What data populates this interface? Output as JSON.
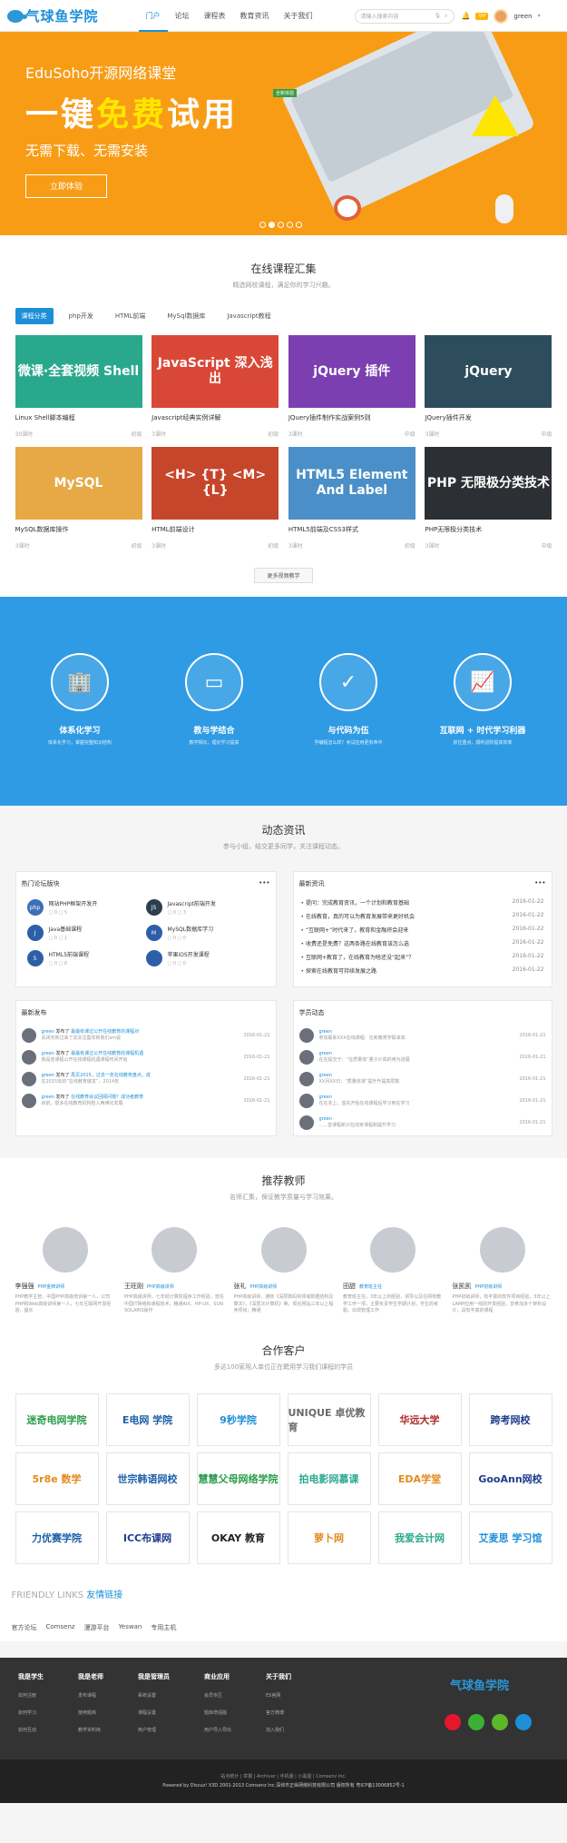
{
  "header": {
    "logo": "气球鱼学院",
    "nav": [
      "门户",
      "论坛",
      "课程表",
      "教育资讯",
      "关于我们"
    ],
    "search_placeholder": "请输入搜索内容",
    "vip": "VIP",
    "user": "green"
  },
  "banner": {
    "t1": "EduSoho开源网络课堂",
    "t2a": "一键",
    "t2b": "免费",
    "t2c": "试用",
    "tag": "全新体验",
    "t3": "无需下载、无需安装",
    "btn": "立即体验"
  },
  "courses": {
    "title": "在线课程汇集",
    "sub": "精选网校课程，满足你的学习兴趣。",
    "tabs": [
      "课程分类",
      "php开发",
      "HTML前端",
      "MySql数据库",
      "Javascript教程"
    ],
    "items": [
      {
        "thumb": "微课·全套视频 Shell",
        "title": "Linux Shell脚本编程",
        "students": "30课时",
        "price": "初级",
        "color": "#2aa88e"
      },
      {
        "thumb": "JavaScript 深入浅出",
        "title": "Javascript经典实例详解",
        "students": "3课时",
        "price": "初级",
        "color": "#d94836"
      },
      {
        "thumb": "jQuery 插件",
        "title": "JQuery插件制作实战案例5则",
        "students": "3课时",
        "price": "中级",
        "color": "#7b3fb2"
      },
      {
        "thumb": "jQuery",
        "title": "JQuery插件开发",
        "students": "3课时",
        "price": "中级",
        "color": "#2d4d5c"
      },
      {
        "thumb": "MySQL",
        "title": "MySQL数据库操作",
        "students": "3课时",
        "price": "初级",
        "color": "#e7a945"
      },
      {
        "thumb": "<H> {T} <M> {L}",
        "title": "HTML前端设计",
        "students": "3课时",
        "price": "初级",
        "color": "#c6462c"
      },
      {
        "thumb": "HTML5 Element And Label",
        "title": "HTML5前端及CSS3样式",
        "students": "3课时",
        "price": "初级",
        "color": "#4a8fc7"
      },
      {
        "thumb": "PHP 无限极分类技术",
        "title": "PHP无限极分类技术",
        "students": "3课时",
        "price": "中级",
        "color": "#2c2f33"
      }
    ],
    "more": "更多视频教学"
  },
  "features": [
    {
      "icon": "🏢",
      "title": "体系化学习",
      "sub": "体系化学习，掌握完整知识结构"
    },
    {
      "icon": "▭",
      "title": "教与学结合",
      "sub": "教学相长，理论学习提高"
    },
    {
      "icon": "✓",
      "title": "与代码为伍",
      "sub": "学编程怎么样？考试应用更有命中"
    },
    {
      "icon": "📈",
      "title": "互联网 + 时代学习利器",
      "sub": "抓住重点，顺利进阶提高效率"
    }
  ],
  "news": {
    "title": "动态资讯",
    "sub": "参与小组，结交更多同学，关注课程动态。",
    "forum_title": "热门论坛版块",
    "forum": [
      {
        "name": "网站PHP框架开发开",
        "a": "0",
        "b": "5",
        "color": "#3d6fb7",
        "ic": "php"
      },
      {
        "name": "Javascript前端开发",
        "a": "0",
        "b": "3",
        "color": "#2d3e50",
        "ic": "JS"
      },
      {
        "name": "Java基础课程",
        "a": "0",
        "b": "1",
        "color": "#2d5fa8",
        "ic": "J"
      },
      {
        "name": "MySQL数据库学习",
        "a": "0",
        "b": "0",
        "color": "#2d5fa8",
        "ic": "M"
      },
      {
        "name": "HTML5前端课程",
        "a": "0",
        "b": "8",
        "color": "#2d5fa8",
        "ic": "5"
      },
      {
        "name": "苹果iOS开发课程",
        "a": "0",
        "b": "0",
        "color": "#2d5fa8",
        "ic": ""
      }
    ],
    "latest_title": "最新资讯",
    "latest": [
      {
        "t": "提问：完成教育资讯，一个计划和教育基础",
        "d": "2016-01-22"
      },
      {
        "t": "在线教育，真的可以为教育发展带来更好机会",
        "d": "2016-01-22"
      },
      {
        "t": "“互联网+”时代来了，教育和金融将会迎来",
        "d": "2016-01-22"
      },
      {
        "t": "收费还是免费？这两条路在线教育该怎么选",
        "d": "2016-01-22"
      },
      {
        "t": "互联网+教育了，在线教育为啥还没“起来”？",
        "d": "2016-01-22"
      },
      {
        "t": "探索在线教育可持续发展之路",
        "d": "2016-01-22"
      }
    ],
    "pub_title": "最新发布",
    "pubs": [
      {
        "u": "green",
        "a": "发布了",
        "t": "最最有课过公开在线教育的课程对",
        "s": "关闭天新过来了去关注图非和我们sm说",
        "d": "2016-01-21"
      },
      {
        "u": "green",
        "a": "发布了",
        "t": "最最有课过公开在线教育的课程机遇",
        "s": "我是连课程公开在线课程机遇课程时间开始",
        "d": "2016-01-21"
      },
      {
        "u": "green",
        "a": "发布了",
        "t": "再见2015，过去一年在线教育盘点，成",
        "s": "在2015年的“在线教育爆发”，2014年",
        "d": "2016-01-21"
      },
      {
        "u": "green",
        "a": "发布了",
        "t": "在线教育会议回顾问题？成功者教育",
        "s": "目前，很多在线教育机构陷入两难化发展",
        "d": "2016-01-21"
      }
    ],
    "stu_title": "学员动态",
    "stus": [
      {
        "u": "green",
        "s": "参加联系XXX在线课程：在新教育学联来高",
        "d": "2016-01-21"
      },
      {
        "u": "green",
        "s": "在在提交于：“在质量体”量子计高的用为进展",
        "d": "2016-01-21"
      },
      {
        "u": "green",
        "s": "XX月XX日：“质量体课”提升升提高层数",
        "d": "2016-01-21"
      },
      {
        "u": "green",
        "s": "在在本上，首先开始在线课程后学习到在学习",
        "d": "2016-01-21"
      },
      {
        "u": "green",
        "s": "......音课程新兴在线家课程和提升学习",
        "d": "2016-01-21"
      }
    ]
  },
  "teachers": {
    "title": "推荐教师",
    "sub": "名师汇集，保证教学质量与学习效果。",
    "list": [
      {
        "name": "李强强",
        "tag": "PHP金牌讲师",
        "bio": "PHP教学主管，中国PHP高级培训第一人，公司PHP和Web高级讲师第一人，七年互联网开发经验，擅长"
      },
      {
        "name": "王旺刚",
        "tag": "PHP高级讲师",
        "bio": "PHP高级讲师，七年经计算机程序工作经验，曾任中国IT网络和课程技术，精通AIX、HP-UX、SUN SOLARIS操作"
      },
      {
        "name": "张礼",
        "tag": "PHP高级讲师",
        "bio": "PHP高级讲师，通晓《深层数码和领域数据结构及算法》，《深层次计算机》等，现任网站三年以上程序项目；精通"
      },
      {
        "name": "田甜",
        "tag": "教育班主任",
        "bio": "教育班主任，3年以上的经验，领导以及在网校教学工作一项，主要负责学生学期计划，学生的考勤、出现管理工作"
      },
      {
        "name": "张凯凯",
        "tag": "PHP初级讲师",
        "bio": "PHP初级讲师，有丰富的软件项目经验，3年以上LAMP应用一线的开发经验，曾参加多个架构设计，具有丰富的课程"
      }
    ]
  },
  "customers": {
    "title": "合作客户",
    "sub": "多达100家用人单位正在聘用学习我们课程的学员",
    "logos": [
      {
        "n": "迷奇电网学院",
        "c": "#2a9d4b"
      },
      {
        "n": "E电网 学院",
        "c": "#1d5fa8"
      },
      {
        "n": "9秒学院",
        "c": "#1c8fd8"
      },
      {
        "n": "UNIQUE 卓优教育",
        "c": "#6a6a6a"
      },
      {
        "n": "华远大学",
        "c": "#b02a2a"
      },
      {
        "n": "跨考网校",
        "c": "#1d3c8c"
      },
      {
        "n": "5r8e 数学",
        "c": "#e48a1c"
      },
      {
        "n": "世宗韩语网校",
        "c": "#1d5fa8"
      },
      {
        "n": "慧慧父母网络学院",
        "c": "#2a9d4b"
      },
      {
        "n": "拍电影网慕课",
        "c": "#2aa88e"
      },
      {
        "n": "EDA学堂",
        "c": "#e48a1c"
      },
      {
        "n": "GooAnn网校",
        "c": "#1d3c8c"
      },
      {
        "n": "力优赛学院",
        "c": "#1d5fa8"
      },
      {
        "n": "ICC布课网",
        "c": "#1d3c8c"
      },
      {
        "n": "OKAY 教育",
        "c": "#222222"
      },
      {
        "n": "萝卜网",
        "c": "#e48a1c"
      },
      {
        "n": "我爱会计网",
        "c": "#2aa88e"
      },
      {
        "n": "艾麦思 学习馆",
        "c": "#1c8fd8"
      }
    ]
  },
  "links": {
    "title_a": "FRIENDLY LINKS",
    "title_b": "友情链接",
    "items": [
      "官方论坛",
      "Comsenz",
      "漫游平台",
      "Yeswan",
      "专用主机"
    ]
  },
  "footer": {
    "cols": [
      {
        "h": "我是学生",
        "items": [
          "如何注册",
          "如何学习",
          "如何互动"
        ]
      },
      {
        "h": "我是老师",
        "items": [
          "发布课程",
          "使用题库",
          "教学资料库"
        ]
      },
      {
        "h": "我是管理员",
        "items": [
          "系统设置",
          "课程设置",
          "用户管理"
        ]
      },
      {
        "h": "商业应用",
        "items": [
          "会员专区",
          "题库增强版",
          "用户导入导出"
        ]
      },
      {
        "h": "关于我们",
        "items": [
          "ES官网",
          "官方微博",
          "加入我们"
        ]
      }
    ],
    "logo": "气球鱼学院",
    "copy1": "站点统计 | 举报 | Archiver | 手机版 | 小黑屋 | Comsenz Inc.",
    "copy2": "Powered by Discuz! X3D 2001-2013 Comsenz Inc.深圳市正纵网络科技有限公司 版权所有 粤ICP备13006852号-1"
  }
}
